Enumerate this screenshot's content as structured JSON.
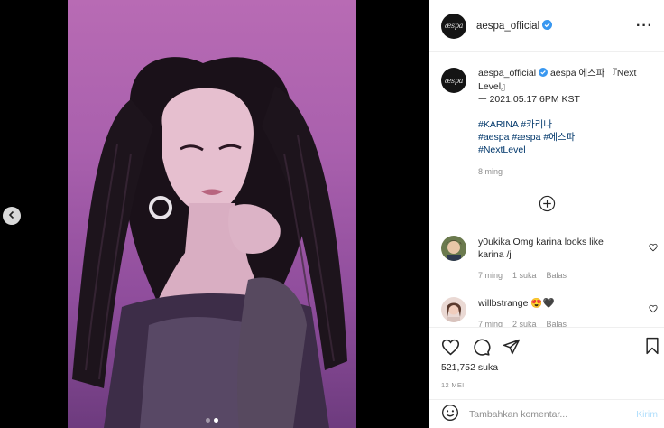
{
  "post": {
    "username": "aespa_official",
    "caption": {
      "text": "aespa 에스파 『Next Level』",
      "line2": "ᅳ 2021.05.17 6PM KST",
      "tags_line1": "#KARINA #카리나",
      "tags_line2": "#aespa #æspa #에스파",
      "tags_line3": "#NextLevel",
      "time": "8 ming"
    },
    "comments": [
      {
        "user": "y0ukika",
        "text": "Omg karina looks like karina /j",
        "time": "7 ming",
        "likes": "1 suka",
        "reply": "Balas"
      },
      {
        "user": "willbstrange",
        "text": "😍🖤",
        "time": "7 ming",
        "likes": "2 suka",
        "reply": "Balas"
      }
    ],
    "like_count": "521,752 suka",
    "date": "12 MEI",
    "composer": {
      "placeholder": "Tambahkan komentar...",
      "post_label": "Kirim"
    }
  },
  "icons": {
    "more": "more-options-icon",
    "verified": "verified-badge-icon",
    "load_more": "load-more-comments-icon",
    "like": "heart-icon",
    "comment": "comment-icon",
    "share": "share-icon",
    "save": "bookmark-icon",
    "emoji": "emoji-icon",
    "prev": "chevron-left-icon"
  },
  "colors": {
    "verified": "#3897f0",
    "hashtag": "#00376b",
    "muted": "#8e8e8e",
    "post_button_disabled": "#b2dffc",
    "photo_bg": "#b86bb4"
  },
  "carousel": {
    "slides": 2,
    "active": 1
  }
}
